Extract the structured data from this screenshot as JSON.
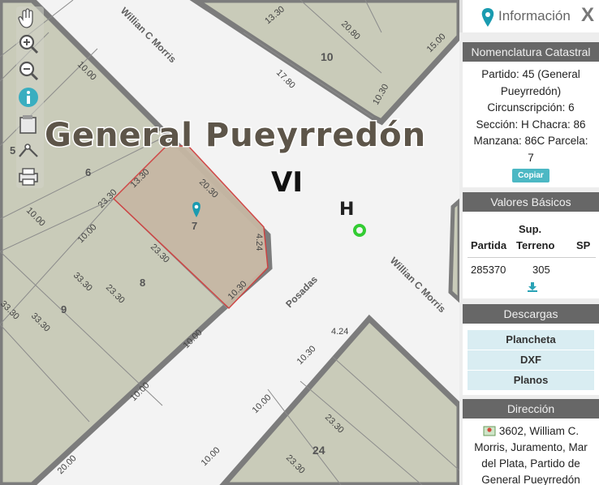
{
  "map": {
    "city_label": "General Pueyrredón",
    "circ_label": "VI",
    "section_label": "H",
    "streets": [
      "Willian C Morris",
      "Willian C Morris",
      "Posadas"
    ],
    "blocks": [
      "10",
      "24"
    ],
    "parcels": [
      "5",
      "6",
      "7",
      "8",
      "9"
    ],
    "dimensions": [
      "13.30",
      "20.80",
      "17.80",
      "10.30",
      "15.00",
      "10.00",
      "13.30",
      "20.30",
      "23.30",
      "4.24",
      "10.30",
      "23.30",
      "10.00",
      "10.00",
      "33.30",
      "23.30",
      "33.30",
      "33.30",
      "10.00",
      "10.00",
      "20.00",
      "4.24",
      "10.30",
      "10.00",
      "23.30",
      "10.00",
      "23.30"
    ]
  },
  "toolbar": {
    "tools": [
      "pan-hand-icon",
      "zoom-in-icon",
      "zoom-out-icon",
      "info-icon",
      "select-icon",
      "measure-icon",
      "print-icon"
    ]
  },
  "panel": {
    "title": "Información",
    "close_label": "X",
    "nomenclatura": {
      "header": "Nomenclatura Catastral",
      "lines": [
        "Partido: 45 (General",
        "Pueyrredón)",
        "Circunscripción: 6",
        "Sección: H Chacra: 86",
        "Manzana: 86C Parcela:",
        "7"
      ],
      "copy_label": "Copiar"
    },
    "valores": {
      "header": "Valores Básicos",
      "col_sup_top": "Sup.",
      "col_partida": "Partida",
      "col_terreno": "Terreno",
      "col_sp": "SP",
      "partida": "285370",
      "terreno": "305",
      "download_icon": "download-icon"
    },
    "descargas": {
      "header": "Descargas",
      "items": [
        "Plancheta",
        "DXF",
        "Planos"
      ]
    },
    "direccion": {
      "header": "Dirección",
      "text": "3602, William C. Morris, Juramento, Mar del Plata, Partido de General Pueyrredón"
    }
  },
  "colors": {
    "street": "#f3f3f3",
    "block": "#c9cbb9",
    "block_border": "#7c7c7c",
    "selected_parcel": "#c6b7a4",
    "selected_border": "#d04040",
    "marker": "#1a9bb0",
    "point": "#33cc33",
    "header": "#676767"
  }
}
